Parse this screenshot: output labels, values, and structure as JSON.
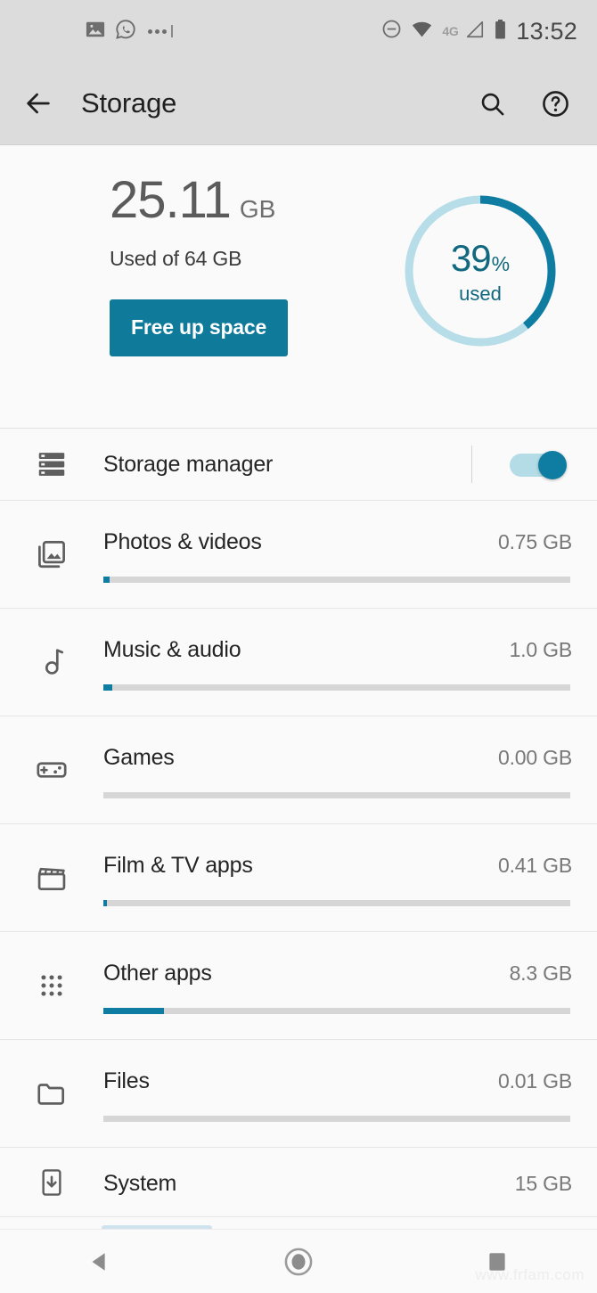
{
  "status_bar": {
    "time": "13:52",
    "network_label": "4G",
    "left_icons": [
      "image-icon",
      "whatsapp-icon",
      "more-notifications-icon"
    ],
    "right_icons": [
      "do-not-disturb-icon",
      "wifi-icon",
      "mobile-signal-icon",
      "battery-icon"
    ]
  },
  "app_bar": {
    "title": "Storage",
    "back_icon": "back-arrow-icon",
    "search_icon": "search-icon",
    "help_icon": "help-icon"
  },
  "summary": {
    "used_value": "25.11",
    "used_unit": "GB",
    "used_of": "Used of 64 GB",
    "free_up_button": "Free up space",
    "gauge": {
      "percent_number": "39",
      "percent_symbol": "%",
      "label": "used",
      "percent_value": 39,
      "track_color": "#b7dde8",
      "fill_color": "#0f7da1"
    }
  },
  "storage_manager": {
    "icon": "storage-manager-icon",
    "label": "Storage manager",
    "toggle_state": "on"
  },
  "categories": [
    {
      "icon": "photos-videos-icon",
      "name": "Photos & videos",
      "size": "0.75 GB",
      "bar_percent": 1.4
    },
    {
      "icon": "music-audio-icon",
      "name": "Music & audio",
      "size": "1.0 GB",
      "bar_percent": 1.9
    },
    {
      "icon": "games-icon",
      "name": "Games",
      "size": "0.00 GB",
      "bar_percent": 0
    },
    {
      "icon": "film-tv-icon",
      "name": "Film & TV apps",
      "size": "0.41 GB",
      "bar_percent": 0.8
    },
    {
      "icon": "other-apps-icon",
      "name": "Other apps",
      "size": "8.3 GB",
      "bar_percent": 13
    },
    {
      "icon": "files-icon",
      "name": "Files",
      "size": "0.01 GB",
      "bar_percent": 0
    },
    {
      "icon": "system-icon",
      "name": "System",
      "size": "15 GB",
      "bar_percent": 23
    }
  ],
  "nav_bar": {
    "back": "nav-back-icon",
    "home": "nav-home-icon",
    "recents": "nav-recents-icon"
  },
  "watermark": "www.frfam.com",
  "colors": {
    "accent": "#0f7da1",
    "accent_dark": "#11687f",
    "chrome": "#dcdcdc",
    "page_bg": "#fafafa",
    "track": "#d6d6d6"
  }
}
